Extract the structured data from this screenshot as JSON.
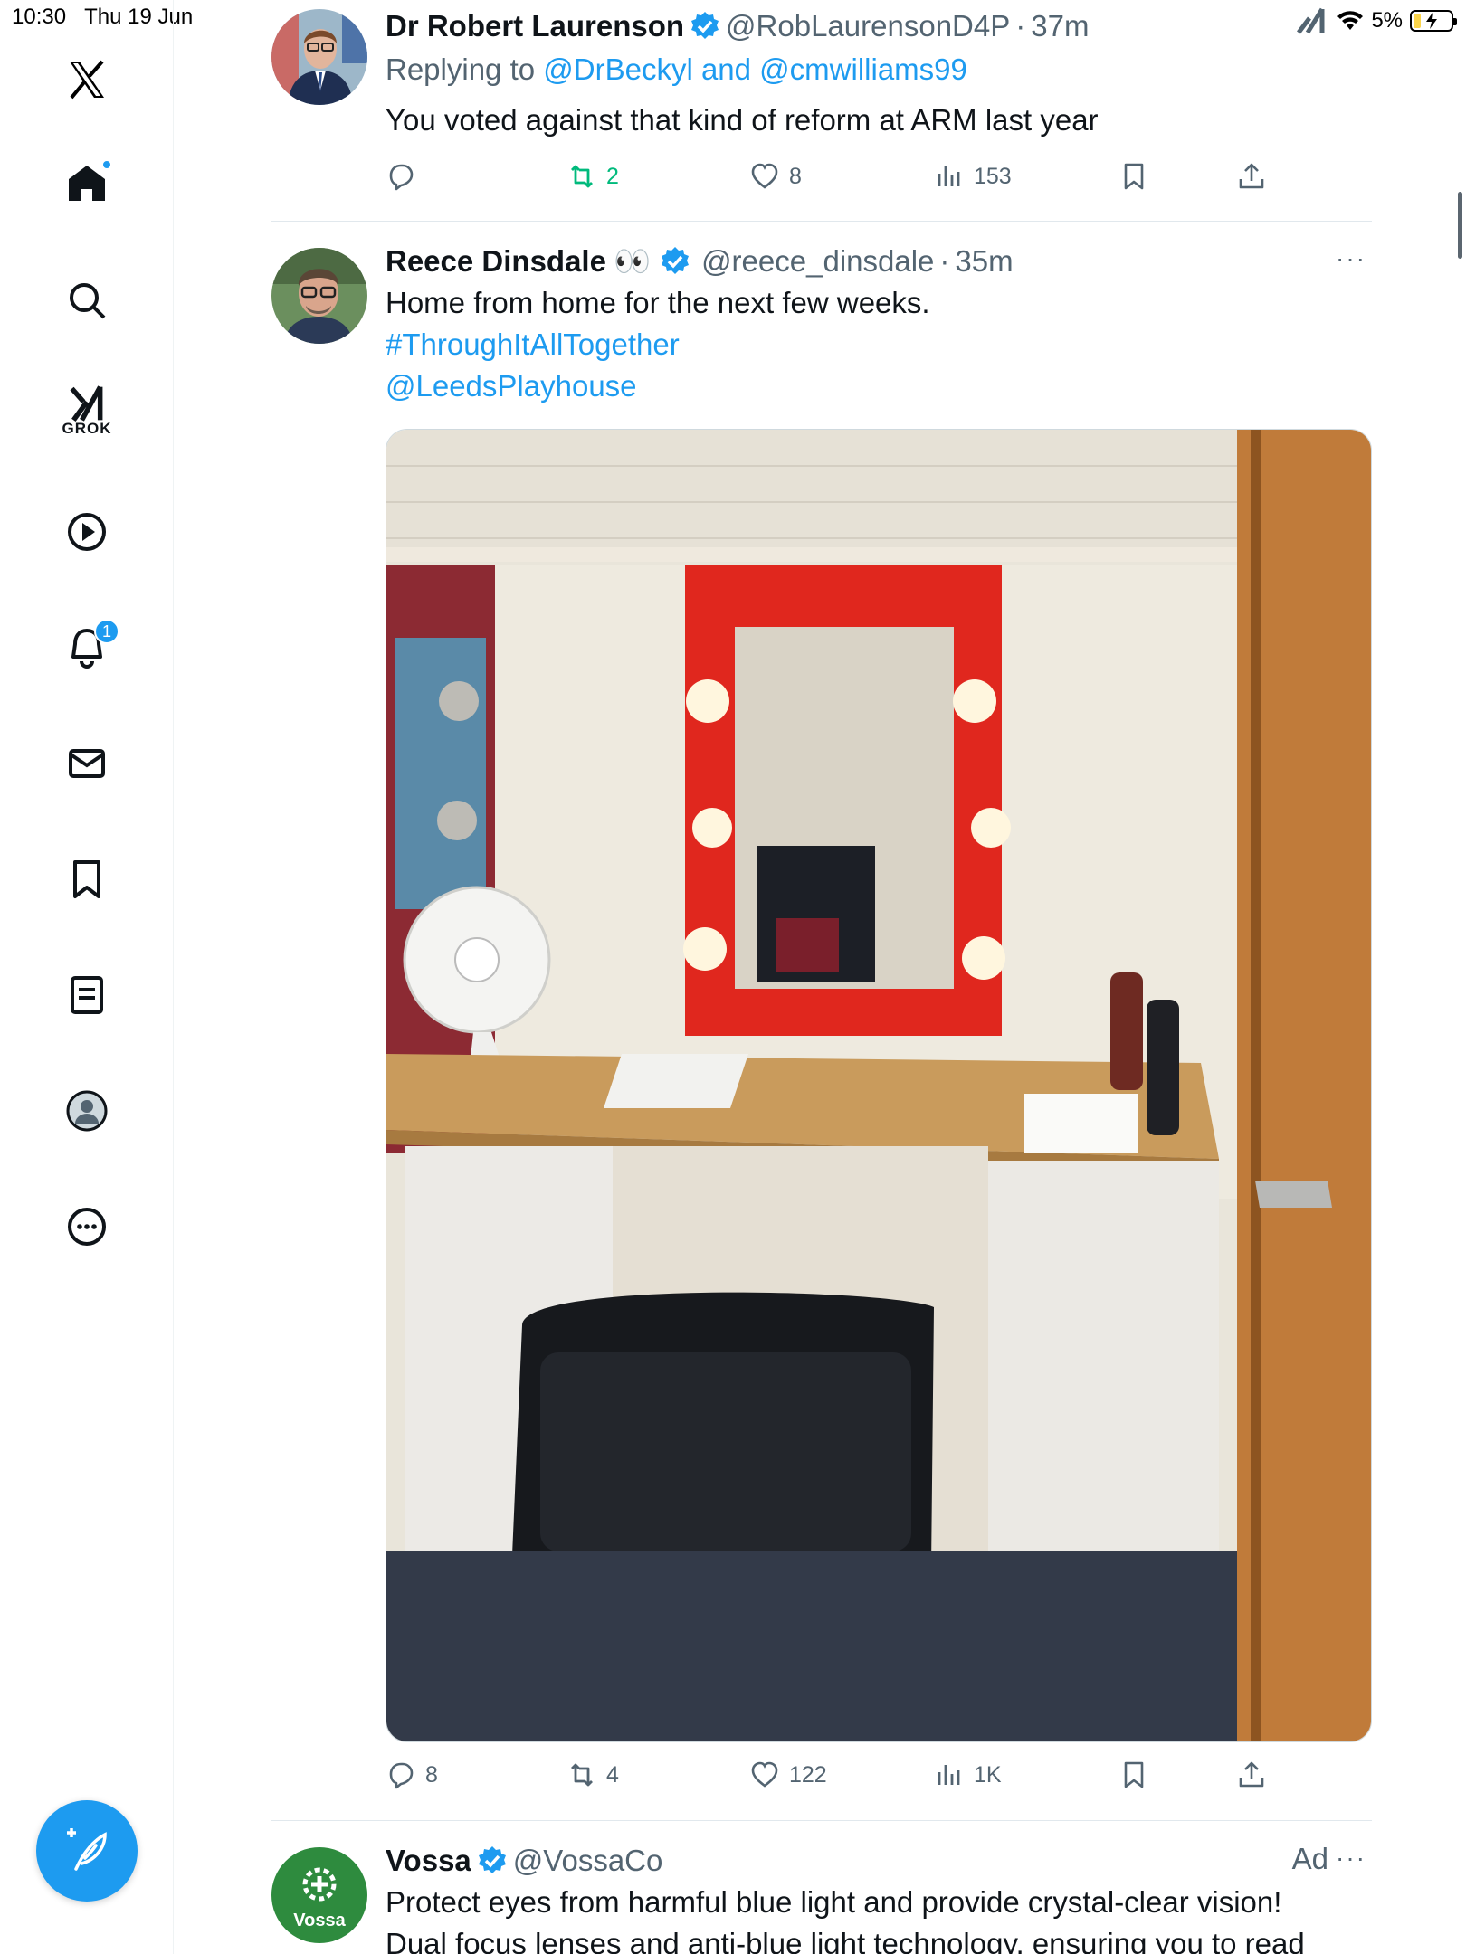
{
  "status_bar": {
    "time": "10:30",
    "date": "Thu 19 Jun",
    "battery": "5%"
  },
  "nav": {
    "items": [
      "home",
      "search",
      "grok",
      "videos",
      "notifications",
      "messages",
      "bookmarks",
      "lists",
      "profile",
      "more"
    ],
    "grok_label": "GROK",
    "notifications_badge": "1"
  },
  "feed": {
    "tweets": [
      {
        "name": "Dr Robert Laurenson",
        "handle": "@RobLaurensonD4P",
        "time": "37m",
        "replying_prefix": "Replying to ",
        "replying_to": "@DrBeckyl and @cmwilliams99",
        "text": "You voted against that kind of reform at ARM last year",
        "replies": "",
        "retweets": "2",
        "likes": "8",
        "views": "153"
      },
      {
        "name": "Reece Dinsdale",
        "emoji": "👀",
        "handle": "@reece_dinsdale",
        "time": "35m",
        "text": "Home from home for the next few weeks.",
        "hashtag": "#ThroughItAllTogether",
        "mention": "@LeedsPlayhouse",
        "replies": "8",
        "retweets": "4",
        "likes": "122",
        "views": "1K"
      },
      {
        "name": "Vossa",
        "handle": "@VossaCo",
        "ad_label": "Ad",
        "logo_text": "Vossa",
        "text_line1": "Protect eyes from harmful blue light and provide crystal-clear vision!",
        "text_line2": "Dual focus lenses and anti-blue light technology, ensuring you to read"
      }
    ]
  },
  "colors": {
    "accent": "#1d9bf0",
    "retweet_active": "#00ba7c",
    "muted": "#536471"
  }
}
